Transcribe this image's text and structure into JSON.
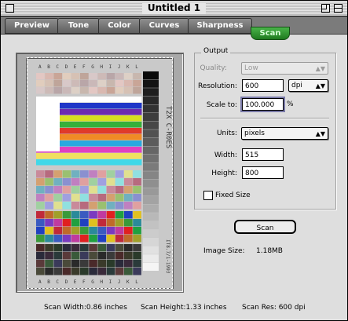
{
  "window": {
    "title": "Untitled 1"
  },
  "tabs": [
    {
      "label": "Preview",
      "active": false
    },
    {
      "label": "Tone",
      "active": false
    },
    {
      "label": "Color",
      "active": false
    },
    {
      "label": "Curves",
      "active": false
    },
    {
      "label": "Sharpness",
      "active": false
    },
    {
      "label": "Scan",
      "active": true
    }
  ],
  "preview": {
    "edge_letters": [
      "A",
      "B",
      "C",
      "D",
      "E",
      "F",
      "G",
      "H",
      "I",
      "J",
      "K",
      "L"
    ],
    "target_label": "T2X  C-R0ES",
    "target_code": "IT8.7/1-1993"
  },
  "output": {
    "group_title": "Output",
    "quality_label": "Quality:",
    "quality_value": "Low",
    "resolution_label": "Resolution:",
    "resolution_value": "600",
    "resolution_unit": "dpi",
    "scale_label": "Scale to:",
    "scale_value": "100.000",
    "scale_unit": "%",
    "units_label": "Units:",
    "units_value": "pixels",
    "width_label": "Width:",
    "width_value": "515",
    "height_label": "Height:",
    "height_value": "800",
    "fixed_size_label": "Fixed Size",
    "fixed_size_checked": false
  },
  "actions": {
    "scan_label": "Scan",
    "image_size_label": "Image Size:",
    "image_size_value": "1.18MB"
  },
  "status": {
    "scan_width": "Scan Width:0.86 inches",
    "scan_height": "Scan Height:1.33 inches",
    "scan_res": "Scan Res:  600  dpi"
  },
  "colors": {
    "active_tab": "#2e9a2e",
    "tab_bar": "#7b7b7b",
    "window_bg": "#dedede"
  }
}
